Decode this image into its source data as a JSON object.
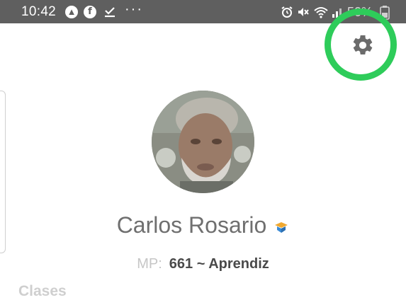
{
  "status_bar": {
    "time": "10:42",
    "notification_icons": [
      "navigation-icon",
      "facebook-icon",
      "download-done-icon"
    ],
    "more_indicator": "···",
    "system_icons": [
      "alarm-icon",
      "mute-icon",
      "wifi-icon",
      "signal-icon",
      "battery-icon"
    ],
    "battery_text": "50%"
  },
  "header": {
    "settings_icon": "gear-icon",
    "highlight_color": "#2ecc5a"
  },
  "profile": {
    "name": "Carlos Rosario",
    "badge_icon": "rank-badge-icon",
    "mp_label": "MP:",
    "mp_value": "661 ~ Aprendiz"
  },
  "sections": {
    "classes_title": "Clases"
  }
}
